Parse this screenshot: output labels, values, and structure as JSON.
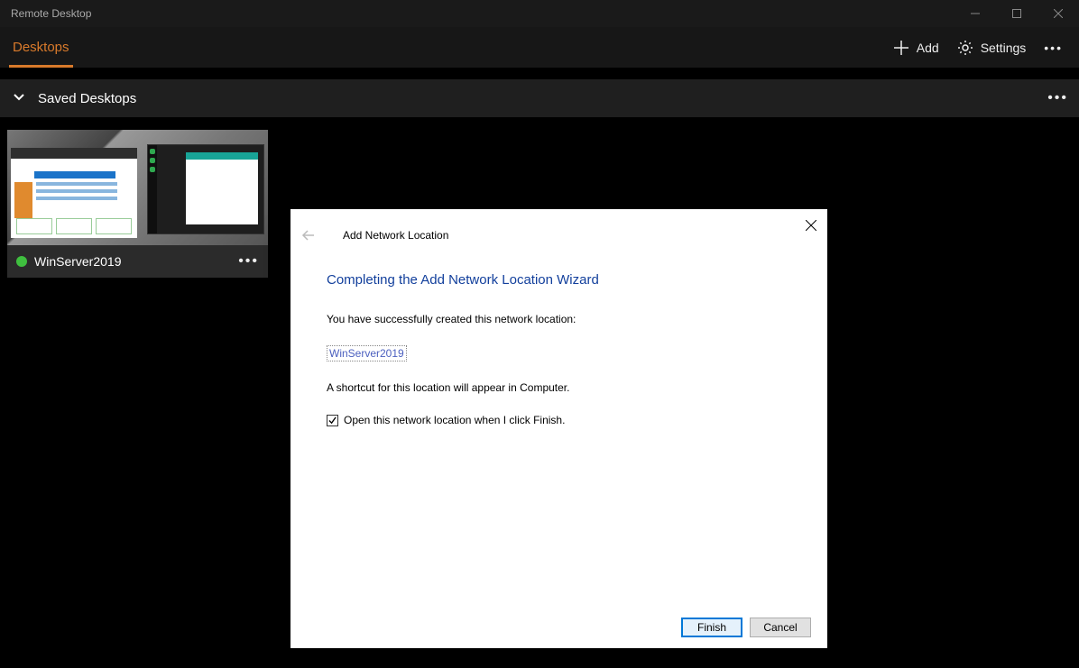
{
  "window": {
    "title": "Remote Desktop"
  },
  "toolbar": {
    "tab_desktops": "Desktops",
    "add_label": "Add",
    "settings_label": "Settings"
  },
  "section": {
    "title": "Saved Desktops"
  },
  "tile": {
    "name": "WinServer2019"
  },
  "dialog": {
    "title": "Add Network Location",
    "heading": "Completing the Add Network Location Wizard",
    "success_text": "You have successfully created this network location:",
    "location_name": "WinServer2019",
    "shortcut_text": "A shortcut for this location will appear in Computer.",
    "open_checkbox_label": "Open this network location when I click Finish.",
    "open_checkbox_checked": true,
    "finish_label": "Finish",
    "cancel_label": "Cancel"
  }
}
